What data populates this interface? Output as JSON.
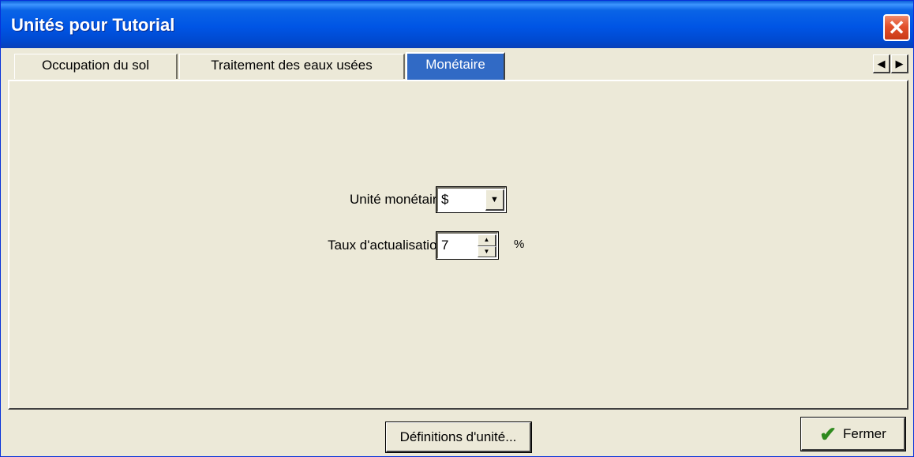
{
  "window": {
    "title": "Unités pour Tutorial",
    "close_glyph": "✕"
  },
  "tabs": [
    {
      "label": "Occupation du sol",
      "active": false
    },
    {
      "label": "Traitement des eaux usées",
      "active": false
    },
    {
      "label": "Monétaire",
      "active": true
    }
  ],
  "tab_scroll": {
    "left_glyph": "◀",
    "right_glyph": "▶"
  },
  "monetary": {
    "unit_label": "Unité monétaire",
    "unit_value": "$",
    "discount_label": "Taux d'actualisation",
    "discount_value": "7",
    "discount_unit": "%"
  },
  "buttons": {
    "definitions_label": "Définitions d'unité...",
    "close_label": "Fermer"
  },
  "colors": {
    "titlebar": "#0055e5",
    "active_tab": "#316ac5",
    "face": "#ece9d8",
    "close_red": "#e2502b",
    "check_green": "#2f8a1e"
  }
}
